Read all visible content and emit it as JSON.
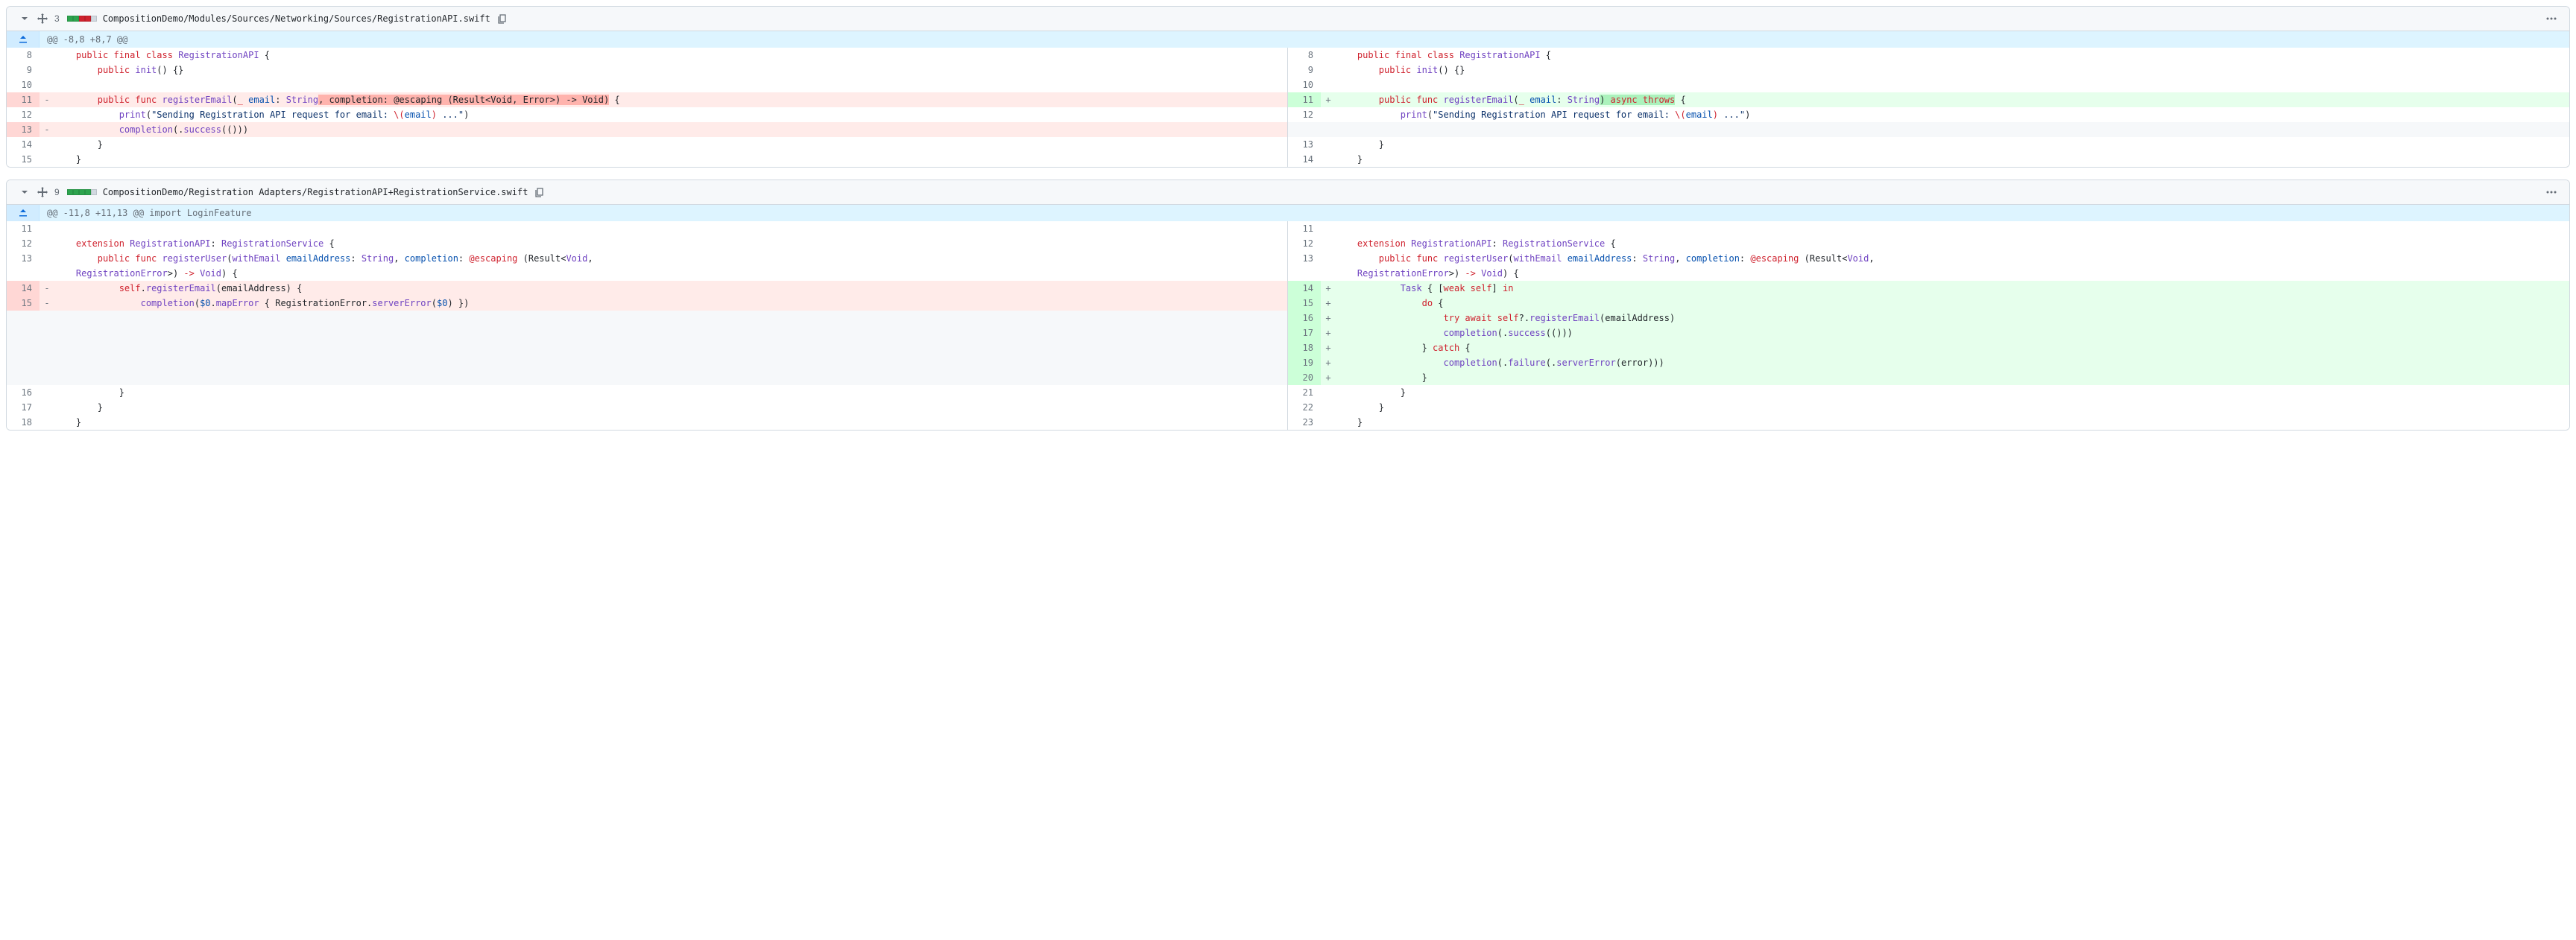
{
  "files": [
    {
      "changeCount": "3",
      "squares": [
        "green",
        "green",
        "red",
        "red",
        "gray"
      ],
      "path": "CompositionDemo/Modules/Sources/Networking/Sources/RegistrationAPI.swift",
      "hunkHeader": "@@ -8,8 +8,7 @@",
      "left": [
        {
          "n": "8",
          "m": "",
          "t": "ctx",
          "segs": [
            [
              "    ",
              ""
            ],
            [
              "public final class ",
              "kw"
            ],
            [
              "RegistrationAPI",
              "type"
            ],
            [
              " {",
              ""
            ]
          ]
        },
        {
          "n": "9",
          "m": "",
          "t": "ctx",
          "segs": [
            [
              "        ",
              ""
            ],
            [
              "public ",
              "kw"
            ],
            [
              "init",
              "func"
            ],
            [
              "() {}",
              ""
            ]
          ]
        },
        {
          "n": "10",
          "m": "",
          "t": "ctx",
          "segs": [
            [
              "",
              ""
            ]
          ]
        },
        {
          "n": "11",
          "m": "-",
          "t": "del",
          "segs": [
            [
              "        ",
              ""
            ],
            [
              "public func ",
              "kw"
            ],
            [
              "registerEmail",
              "func"
            ],
            [
              "(",
              ""
            ],
            [
              "_",
              "kw"
            ],
            [
              " ",
              ""
            ],
            [
              "email",
              "param"
            ],
            [
              ": ",
              ""
            ],
            [
              "String",
              "type"
            ],
            [
              ", completion: @escaping (Result<Void, Error>) -> Void)",
              "hl-del"
            ],
            [
              " {",
              ""
            ]
          ]
        },
        {
          "n": "12",
          "m": "",
          "t": "ctx",
          "segs": [
            [
              "            ",
              ""
            ],
            [
              "print",
              "func"
            ],
            [
              "(",
              ""
            ],
            [
              "\"Sending Registration API request for email: ",
              "str"
            ],
            [
              "\\(",
              "kw"
            ],
            [
              "email",
              "param"
            ],
            [
              ")",
              "kw"
            ],
            [
              " ...\"",
              "str"
            ],
            [
              ")",
              ""
            ]
          ]
        },
        {
          "n": "13",
          "m": "-",
          "t": "del",
          "segs": [
            [
              "            ",
              ""
            ],
            [
              "completion",
              "func"
            ],
            [
              "(.",
              ""
            ],
            [
              "success",
              "func"
            ],
            [
              "(()))",
              ""
            ]
          ]
        },
        {
          "n": "14",
          "m": "",
          "t": "ctx",
          "segs": [
            [
              "        }",
              ""
            ]
          ]
        },
        {
          "n": "15",
          "m": "",
          "t": "ctx",
          "segs": [
            [
              "    }",
              ""
            ]
          ]
        }
      ],
      "right": [
        {
          "n": "8",
          "m": "",
          "t": "ctx",
          "segs": [
            [
              "    ",
              ""
            ],
            [
              "public final class ",
              "kw"
            ],
            [
              "RegistrationAPI",
              "type"
            ],
            [
              " {",
              ""
            ]
          ]
        },
        {
          "n": "9",
          "m": "",
          "t": "ctx",
          "segs": [
            [
              "        ",
              ""
            ],
            [
              "public ",
              "kw"
            ],
            [
              "init",
              "func"
            ],
            [
              "() {}",
              ""
            ]
          ]
        },
        {
          "n": "10",
          "m": "",
          "t": "ctx",
          "segs": [
            [
              "",
              ""
            ]
          ]
        },
        {
          "n": "11",
          "m": "+",
          "t": "add",
          "segs": [
            [
              "        ",
              ""
            ],
            [
              "public func ",
              "kw"
            ],
            [
              "registerEmail",
              "func"
            ],
            [
              "(",
              ""
            ],
            [
              "_",
              "kw"
            ],
            [
              " ",
              ""
            ],
            [
              "email",
              "param"
            ],
            [
              ": ",
              ""
            ],
            [
              "String",
              "type"
            ],
            [
              ") ",
              "hl-add"
            ],
            [
              "async throws",
              "kw hl-add"
            ],
            [
              " {",
              ""
            ]
          ]
        },
        {
          "n": "12",
          "m": "",
          "t": "ctx",
          "segs": [
            [
              "            ",
              ""
            ],
            [
              "print",
              "func"
            ],
            [
              "(",
              ""
            ],
            [
              "\"Sending Registration API request for email: ",
              "str"
            ],
            [
              "\\(",
              "kw"
            ],
            [
              "email",
              "param"
            ],
            [
              ")",
              "kw"
            ],
            [
              " ...\"",
              "str"
            ],
            [
              ")",
              ""
            ]
          ]
        },
        {
          "n": "",
          "m": "",
          "t": "empty",
          "segs": [
            [
              "",
              ""
            ]
          ]
        },
        {
          "n": "13",
          "m": "",
          "t": "ctx",
          "segs": [
            [
              "        }",
              ""
            ]
          ]
        },
        {
          "n": "14",
          "m": "",
          "t": "ctx",
          "segs": [
            [
              "    }",
              ""
            ]
          ]
        }
      ]
    },
    {
      "changeCount": "9",
      "squares": [
        "green",
        "green",
        "green",
        "green",
        "gray"
      ],
      "path": "CompositionDemo/Registration Adapters/RegistrationAPI+RegistrationService.swift",
      "hunkHeader": "@@ -11,8 +11,13 @@ import LoginFeature",
      "left": [
        {
          "n": "11",
          "m": "",
          "t": "ctx",
          "segs": [
            [
              "",
              ""
            ]
          ]
        },
        {
          "n": "12",
          "m": "",
          "t": "ctx",
          "segs": [
            [
              "    ",
              ""
            ],
            [
              "extension ",
              "kw"
            ],
            [
              "RegistrationAPI",
              "type"
            ],
            [
              ": ",
              ""
            ],
            [
              "RegistrationService",
              "type"
            ],
            [
              " {",
              ""
            ]
          ]
        },
        {
          "n": "13",
          "m": "",
          "t": "ctx",
          "segs": [
            [
              "        ",
              ""
            ],
            [
              "public func ",
              "kw"
            ],
            [
              "registerUser",
              "func"
            ],
            [
              "(",
              ""
            ],
            [
              "withEmail",
              "func"
            ],
            [
              " ",
              ""
            ],
            [
              "emailAddress",
              "param"
            ],
            [
              ": ",
              ""
            ],
            [
              "String",
              "type"
            ],
            [
              ", ",
              ""
            ],
            [
              "completion",
              "param"
            ],
            [
              ": ",
              ""
            ],
            [
              "@escaping",
              "kw"
            ],
            [
              " (Result<",
              ""
            ],
            [
              "Void",
              "type"
            ],
            [
              ", \n    ",
              ""
            ],
            [
              "RegistrationError",
              "type"
            ],
            [
              ">) ",
              ""
            ],
            [
              "->",
              "op"
            ],
            [
              " ",
              ""
            ],
            [
              "Void",
              "type"
            ],
            [
              ") {",
              ""
            ]
          ]
        },
        {
          "n": "14",
          "m": "-",
          "t": "del",
          "segs": [
            [
              "            ",
              ""
            ],
            [
              "self",
              "kw"
            ],
            [
              ".",
              ""
            ],
            [
              "registerEmail",
              "func"
            ],
            [
              "(emailAddress) {",
              ""
            ]
          ]
        },
        {
          "n": "15",
          "m": "-",
          "t": "del",
          "segs": [
            [
              "                ",
              ""
            ],
            [
              "completion",
              "func"
            ],
            [
              "(",
              ""
            ],
            [
              "$0",
              "param"
            ],
            [
              ".",
              ""
            ],
            [
              "mapError",
              "func"
            ],
            [
              " { RegistrationError.",
              ""
            ],
            [
              "serverError",
              "func"
            ],
            [
              "(",
              ""
            ],
            [
              "$0",
              "param"
            ],
            [
              ") })",
              ""
            ]
          ]
        },
        {
          "n": "",
          "m": "",
          "t": "empty",
          "segs": [
            [
              "",
              ""
            ]
          ]
        },
        {
          "n": "",
          "m": "",
          "t": "empty",
          "segs": [
            [
              "",
              ""
            ]
          ]
        },
        {
          "n": "",
          "m": "",
          "t": "empty",
          "segs": [
            [
              "",
              ""
            ]
          ]
        },
        {
          "n": "",
          "m": "",
          "t": "empty",
          "segs": [
            [
              "",
              ""
            ]
          ]
        },
        {
          "n": "",
          "m": "",
          "t": "empty",
          "segs": [
            [
              "",
              ""
            ]
          ]
        },
        {
          "n": "16",
          "m": "",
          "t": "ctx",
          "segs": [
            [
              "            }",
              ""
            ]
          ]
        },
        {
          "n": "17",
          "m": "",
          "t": "ctx",
          "segs": [
            [
              "        }",
              ""
            ]
          ]
        },
        {
          "n": "18",
          "m": "",
          "t": "ctx",
          "segs": [
            [
              "    }",
              ""
            ]
          ]
        }
      ],
      "right": [
        {
          "n": "11",
          "m": "",
          "t": "ctx",
          "segs": [
            [
              "",
              ""
            ]
          ]
        },
        {
          "n": "12",
          "m": "",
          "t": "ctx",
          "segs": [
            [
              "    ",
              ""
            ],
            [
              "extension ",
              "kw"
            ],
            [
              "RegistrationAPI",
              "type"
            ],
            [
              ": ",
              ""
            ],
            [
              "RegistrationService",
              "type"
            ],
            [
              " {",
              ""
            ]
          ]
        },
        {
          "n": "13",
          "m": "",
          "t": "ctx",
          "segs": [
            [
              "        ",
              ""
            ],
            [
              "public func ",
              "kw"
            ],
            [
              "registerUser",
              "func"
            ],
            [
              "(",
              ""
            ],
            [
              "withEmail",
              "func"
            ],
            [
              " ",
              ""
            ],
            [
              "emailAddress",
              "param"
            ],
            [
              ": ",
              ""
            ],
            [
              "String",
              "type"
            ],
            [
              ", ",
              ""
            ],
            [
              "completion",
              "param"
            ],
            [
              ": ",
              ""
            ],
            [
              "@escaping",
              "kw"
            ],
            [
              " (Result<",
              ""
            ],
            [
              "Void",
              "type"
            ],
            [
              ", \n    ",
              ""
            ],
            [
              "RegistrationError",
              "type"
            ],
            [
              ">) ",
              ""
            ],
            [
              "->",
              "op"
            ],
            [
              " ",
              ""
            ],
            [
              "Void",
              "type"
            ],
            [
              ") {",
              ""
            ]
          ]
        },
        {
          "n": "14",
          "m": "+",
          "t": "add",
          "segs": [
            [
              "            ",
              ""
            ],
            [
              "Task",
              "type"
            ],
            [
              " { [",
              ""
            ],
            [
              "weak ",
              "kw"
            ],
            [
              "self",
              "kw"
            ],
            [
              "] ",
              ""
            ],
            [
              "in",
              "kw"
            ]
          ]
        },
        {
          "n": "15",
          "m": "+",
          "t": "add",
          "segs": [
            [
              "                ",
              ""
            ],
            [
              "do",
              "kw"
            ],
            [
              " {",
              ""
            ]
          ]
        },
        {
          "n": "16",
          "m": "+",
          "t": "add",
          "segs": [
            [
              "                    ",
              ""
            ],
            [
              "try await ",
              "kw"
            ],
            [
              "self",
              "kw"
            ],
            [
              "?.",
              ""
            ],
            [
              "registerEmail",
              "func"
            ],
            [
              "(emailAddress)",
              ""
            ]
          ]
        },
        {
          "n": "17",
          "m": "+",
          "t": "add",
          "segs": [
            [
              "                    ",
              ""
            ],
            [
              "completion",
              "func"
            ],
            [
              "(.",
              ""
            ],
            [
              "success",
              "func"
            ],
            [
              "(()))",
              ""
            ]
          ]
        },
        {
          "n": "18",
          "m": "+",
          "t": "add",
          "segs": [
            [
              "                } ",
              ""
            ],
            [
              "catch",
              "kw"
            ],
            [
              " {",
              ""
            ]
          ]
        },
        {
          "n": "19",
          "m": "+",
          "t": "add",
          "segs": [
            [
              "                    ",
              ""
            ],
            [
              "completion",
              "func"
            ],
            [
              "(.",
              ""
            ],
            [
              "failure",
              "func"
            ],
            [
              "(.",
              ""
            ],
            [
              "serverError",
              "func"
            ],
            [
              "(error)))",
              ""
            ]
          ]
        },
        {
          "n": "20",
          "m": "+",
          "t": "add",
          "segs": [
            [
              "                }",
              ""
            ]
          ]
        },
        {
          "n": "21",
          "m": "",
          "t": "ctx",
          "segs": [
            [
              "            }",
              ""
            ]
          ]
        },
        {
          "n": "22",
          "m": "",
          "t": "ctx",
          "segs": [
            [
              "        }",
              ""
            ]
          ]
        },
        {
          "n": "23",
          "m": "",
          "t": "ctx",
          "segs": [
            [
              "    }",
              ""
            ]
          ]
        }
      ]
    }
  ]
}
